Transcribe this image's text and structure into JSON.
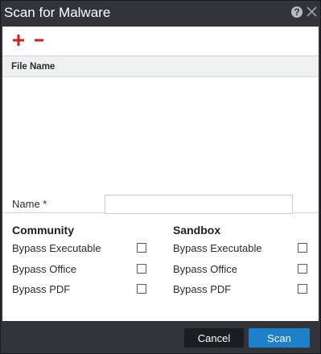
{
  "dialog": {
    "title": "Scan for Malware"
  },
  "toolbar": {
    "add_icon": "plus-icon",
    "remove_icon": "minus-icon",
    "accent_add": "#d0211c",
    "accent_remove": "#d0211c"
  },
  "grid": {
    "columns": [
      "File Name"
    ],
    "rows": []
  },
  "form": {
    "name_label": "Name *",
    "name_value": "",
    "community": {
      "title": "Community",
      "options": [
        {
          "label": "Bypass Executable",
          "checked": false
        },
        {
          "label": "Bypass Office",
          "checked": false
        },
        {
          "label": "Bypass PDF",
          "checked": false
        }
      ]
    },
    "sandbox": {
      "title": "Sandbox",
      "options": [
        {
          "label": "Bypass Executable",
          "checked": false
        },
        {
          "label": "Bypass Office",
          "checked": false
        },
        {
          "label": "Bypass PDF",
          "checked": false
        }
      ]
    }
  },
  "footer": {
    "cancel_label": "Cancel",
    "scan_label": "Scan",
    "scan_color": "#1e7fcb"
  }
}
